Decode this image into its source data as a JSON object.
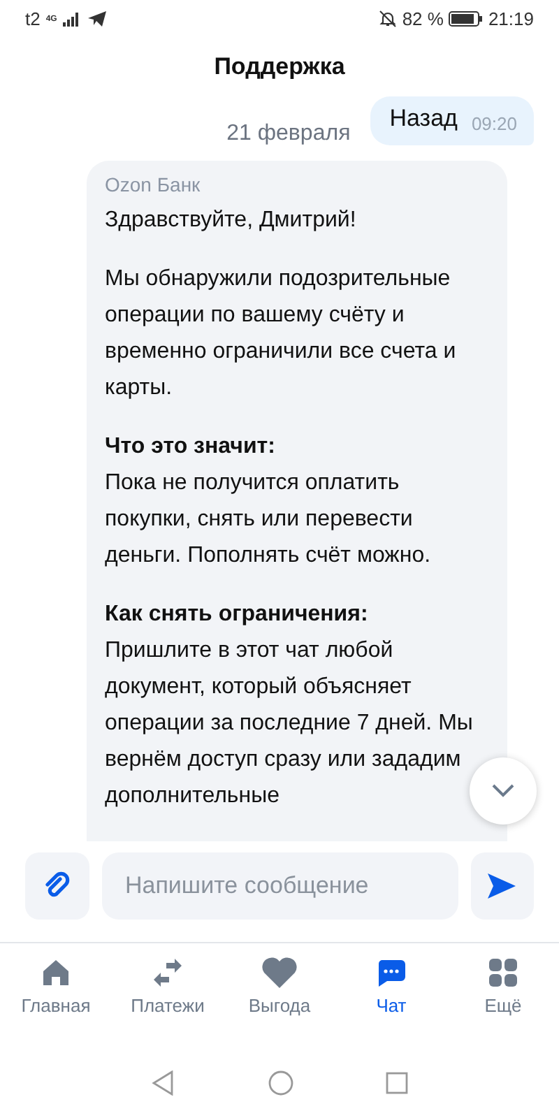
{
  "status_bar": {
    "carrier": "t2",
    "network": "4G",
    "battery": "82 %",
    "time": "21:19"
  },
  "header": {
    "title": "Поддержка"
  },
  "outgoing": {
    "text": "Назад",
    "time": "09:20"
  },
  "date": "21 февраля",
  "message": {
    "sender": "Ozon Банк",
    "sections": [
      {
        "text": "Здравствуйте, Дмитрий!"
      },
      {
        "text": "Мы обнаружили подозрительные операции по вашему счёту и временно ограничили все счета и карты."
      },
      {
        "heading": "Что это значит:",
        "text": "Пока не получится оплатить покупки, снять или перевести деньги. Пополнять счёт можно."
      },
      {
        "heading": "Как снять ограничения:",
        "text": "Пришлите в этот чат любой документ, который объясняет операции за последние 7 дней. Мы вернём доступ сразу или зададим дополнительные"
      }
    ]
  },
  "composer": {
    "placeholder": "Напишите сообщение"
  },
  "tabs": [
    {
      "label": "Главная",
      "selected": false,
      "kind": "home"
    },
    {
      "label": "Платежи",
      "selected": false,
      "kind": "transfer"
    },
    {
      "label": "Выгода",
      "selected": false,
      "kind": "heart"
    },
    {
      "label": "Чат",
      "selected": true,
      "kind": "chat"
    },
    {
      "label": "Ещё",
      "selected": false,
      "kind": "grid"
    }
  ]
}
